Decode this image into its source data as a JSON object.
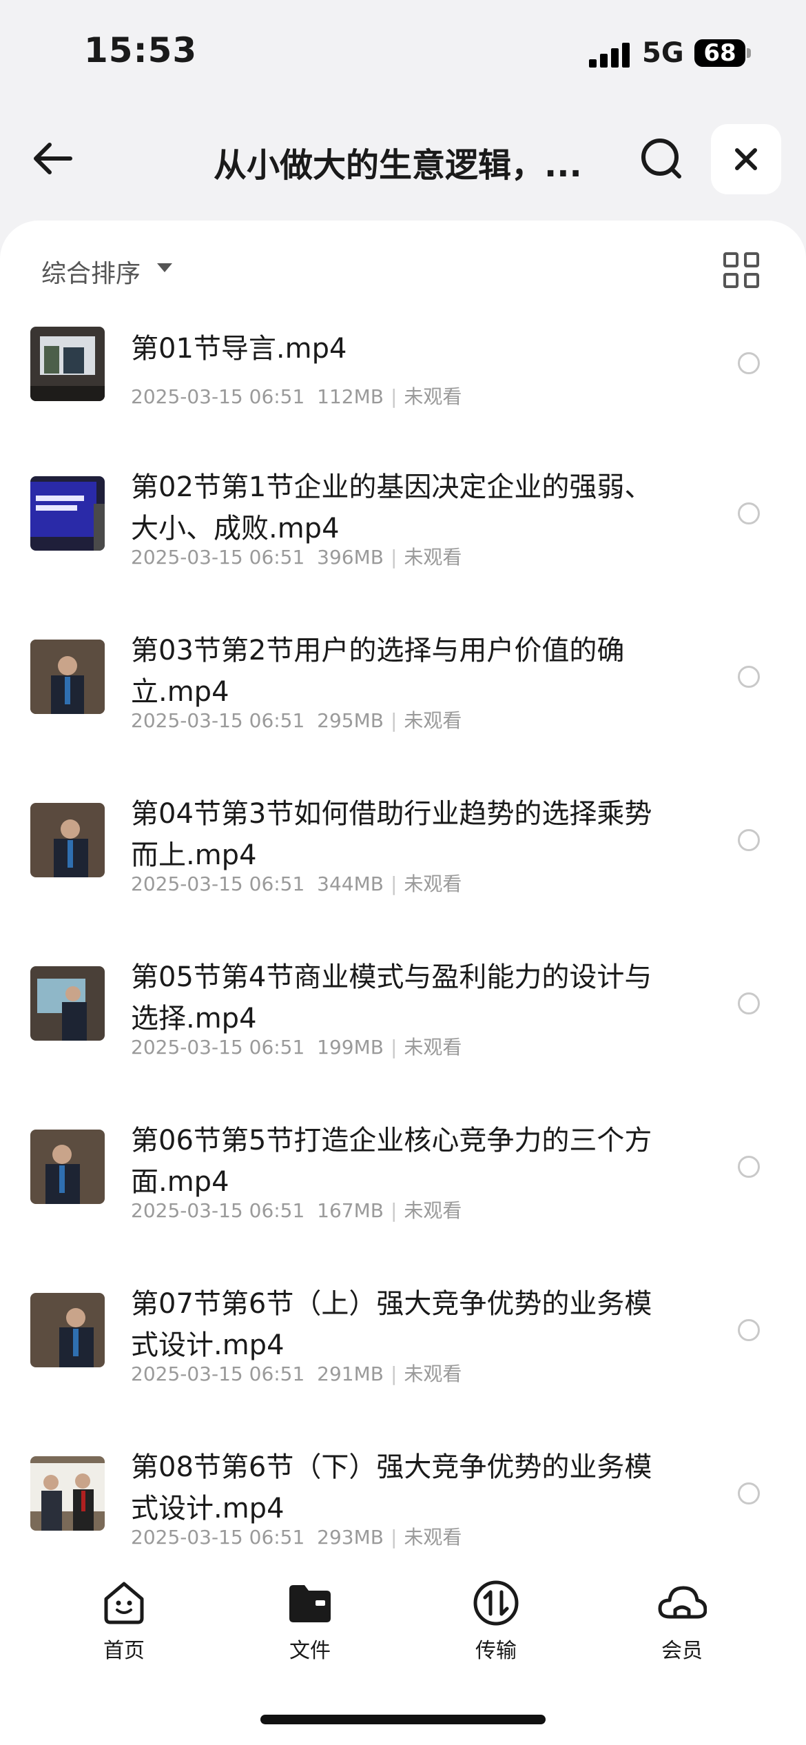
{
  "status_bar": {
    "time": "15:53",
    "network": "5G",
    "battery": "68"
  },
  "nav": {
    "title": "从小做大的生意逻辑，..."
  },
  "toolbar": {
    "sort_label": "综合排序"
  },
  "files": [
    {
      "name": "第01节导言.mp4",
      "date": "2025-03-15 06:51",
      "size": "112MB",
      "status": "未观看"
    },
    {
      "name": "第02节第1节企业的基因决定企业的强弱、大小、成败.mp4",
      "date": "2025-03-15 06:51",
      "size": "396MB",
      "status": "未观看"
    },
    {
      "name": "第03节第2节用户的选择与用户价值的确立.mp4",
      "date": "2025-03-15 06:51",
      "size": "295MB",
      "status": "未观看"
    },
    {
      "name": "第04节第3节如何借助行业趋势的选择乘势而上.mp4",
      "date": "2025-03-15 06:51",
      "size": "344MB",
      "status": "未观看"
    },
    {
      "name": "第05节第4节商业模式与盈利能力的设计与选择.mp4",
      "date": "2025-03-15 06:51",
      "size": "199MB",
      "status": "未观看"
    },
    {
      "name": "第06节第5节打造企业核心竞争力的三个方面.mp4",
      "date": "2025-03-15 06:51",
      "size": "167MB",
      "status": "未观看"
    },
    {
      "name": "第07节第6节（上）强大竞争优势的业务模式设计.mp4",
      "date": "2025-03-15 06:51",
      "size": "291MB",
      "status": "未观看"
    },
    {
      "name": "第08节第6节（下）强大竞争优势的业务模式设计.mp4",
      "date": "2025-03-15 06:51",
      "size": "293MB",
      "status": "未观看"
    }
  ],
  "tabs": [
    {
      "label": "首页",
      "icon": "home-face-icon"
    },
    {
      "label": "文件",
      "icon": "folder-icon"
    },
    {
      "label": "传输",
      "icon": "transfer-icon"
    },
    {
      "label": "会员",
      "icon": "cloud-icon"
    }
  ]
}
